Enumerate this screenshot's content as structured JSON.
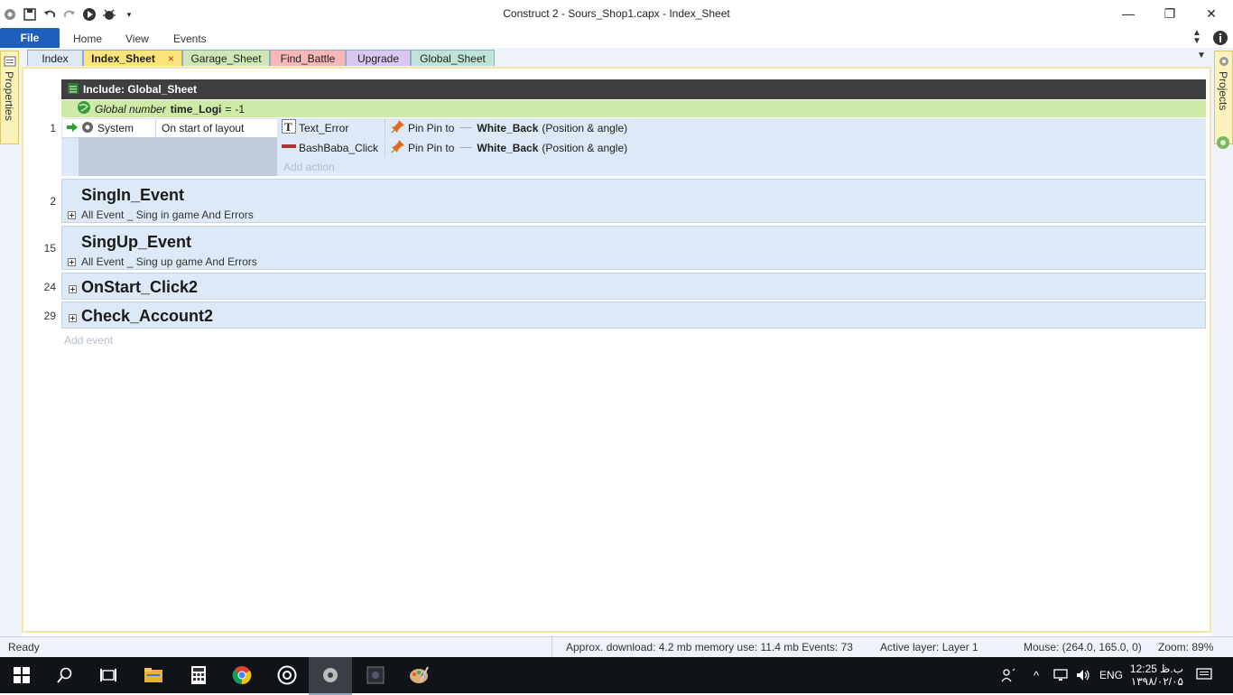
{
  "window": {
    "title": "Construct 2 - Sours_Shop1.capx - Index_Sheet",
    "minimize": "—",
    "restore": "❐",
    "close": "✕"
  },
  "ribbon": {
    "file": "File",
    "tabs": [
      "Home",
      "View",
      "Events"
    ]
  },
  "sheet_tabs": [
    {
      "label": "Index",
      "color": "#dfe8f5"
    },
    {
      "label": "Index_Sheet",
      "color": "#fde47a",
      "active": true,
      "close": "×"
    },
    {
      "label": "Garage_Sheet",
      "color": "#cfe6b6"
    },
    {
      "label": "Find_Battle",
      "color": "#f7b7b7"
    },
    {
      "label": "Upgrade",
      "color": "#d8c8ef"
    },
    {
      "label": "Global_Sheet",
      "color": "#bfe3d8"
    }
  ],
  "side_panels": {
    "left": "Properties",
    "right": "Projects"
  },
  "events": {
    "include": "Include: Global_Sheet",
    "global_var": {
      "kind": "Global number",
      "name": "time_Logi",
      "eq": "=",
      "value": "-1"
    },
    "event1": {
      "number": "1",
      "object": "System",
      "condition": "On start of layout",
      "actions": [
        {
          "object": "Text_Error",
          "action": "Pin Pin to",
          "target": "White_Back",
          "param": "(Position & angle)"
        },
        {
          "object": "BashBaba_Click",
          "action": "Pin Pin to",
          "target": "White_Back",
          "param": "(Position & angle)"
        }
      ],
      "add_action": "Add action"
    },
    "groups": [
      {
        "number": "2",
        "title": "SingIn_Event",
        "desc": "All Event _ Sing in game And Errors"
      },
      {
        "number": "15",
        "title": "SingUp_Event",
        "desc": "All Event _ Sing up game And Errors"
      },
      {
        "number": "24",
        "title": "OnStart_Click2",
        "desc": ""
      },
      {
        "number": "29",
        "title": "Check_Account2",
        "desc": ""
      }
    ],
    "add_event": "Add event"
  },
  "status": {
    "ready": "Ready",
    "download": "Approx. download: 4.2 mb  memory use: 11.4 mb  Events: 73",
    "layer": "Active layer: Layer 1",
    "mouse": "Mouse: (264.0, 165.0, 0)",
    "zoom": "Zoom: 89%"
  },
  "taskbar": {
    "lang": "ENG",
    "time": "12:25 ب.ظ",
    "date": "۱۳۹۸/۰۲/۰۵"
  }
}
